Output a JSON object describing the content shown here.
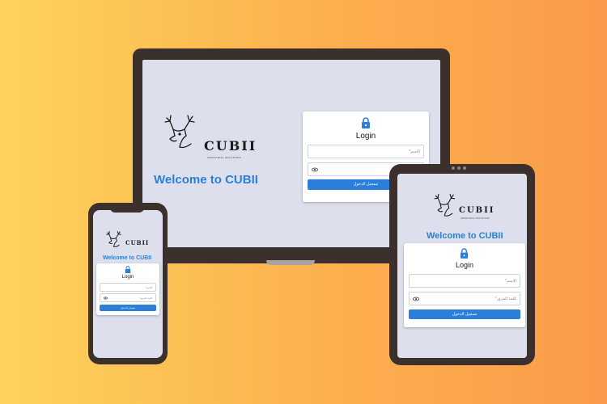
{
  "brand": {
    "name": "CUBII",
    "tagline": "INDUSTRIAL SOLUTIONS"
  },
  "welcome_text": "Welcome to CUBII",
  "login": {
    "title": "Login",
    "username_placeholder": "الاسم*",
    "password_placeholder": "كلمة المرور*",
    "submit_label": "تسجيل الدخول"
  },
  "colors": {
    "accent": "#2b7fd8",
    "screen_bg": "#dde0ec",
    "frame": "#3b302b"
  },
  "icons": [
    "deer-logo-icon",
    "lock-icon",
    "eye-icon"
  ]
}
